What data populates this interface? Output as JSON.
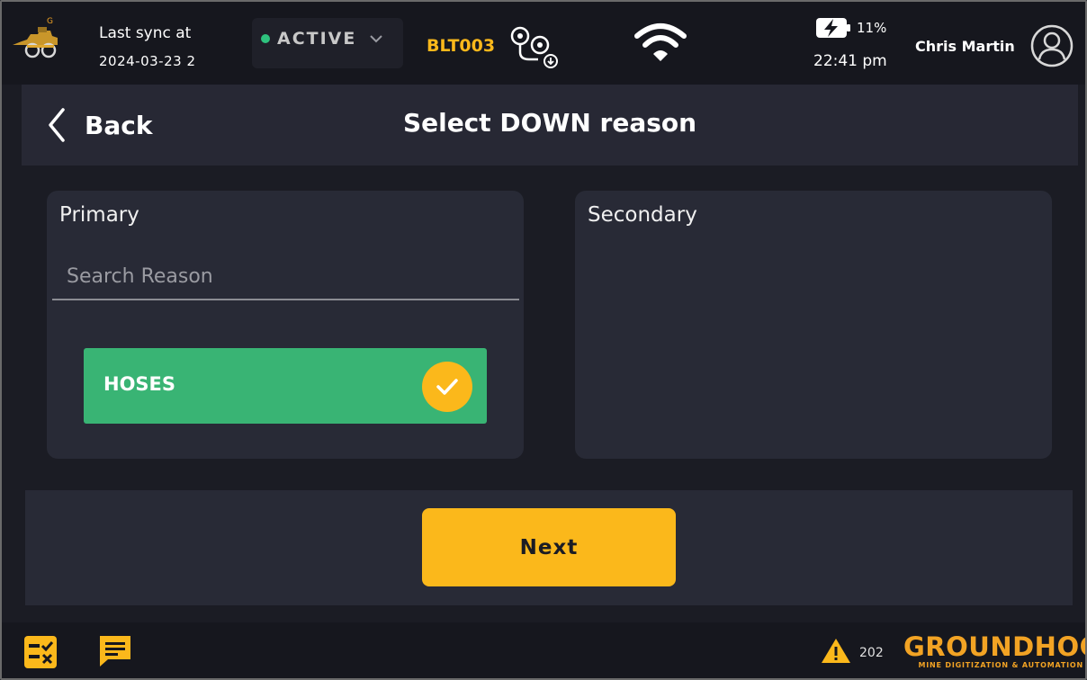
{
  "topbar": {
    "sync_label": "Last sync at",
    "sync_date": "2024-03-23 2",
    "status": "ACTIVE",
    "status_color": "#2ec27e",
    "machine_id": "BLT003",
    "battery_pct": "11%",
    "time": "22:41 pm",
    "user_name": "Chris Martin",
    "icons": [
      "machine-logo-icon",
      "chevron-down-icon",
      "route-icon",
      "wifi-icon",
      "battery-charging-icon",
      "user-avatar-icon"
    ]
  },
  "header": {
    "back_label": "Back",
    "title": "Select DOWN reason"
  },
  "primary": {
    "title": "Primary",
    "search_placeholder": "Search Reason",
    "search_value": "",
    "items": [
      {
        "label": "HOSES",
        "selected": true
      }
    ]
  },
  "secondary": {
    "title": "Secondary",
    "items": []
  },
  "actions": {
    "next_label": "Next"
  },
  "bottombar": {
    "warning_text": "202",
    "brand_name": "GROUNDHOG",
    "brand_tagline": "MINE DIGITIZATION & AUTOMATION",
    "icons": [
      "checklist-icon",
      "chat-icon",
      "warning-icon"
    ]
  },
  "colors": {
    "accent": "#fbb81b",
    "selected_item": "#39b474",
    "background": "#1b1c24",
    "panel": "#282a36",
    "brand": "#f2a324"
  }
}
